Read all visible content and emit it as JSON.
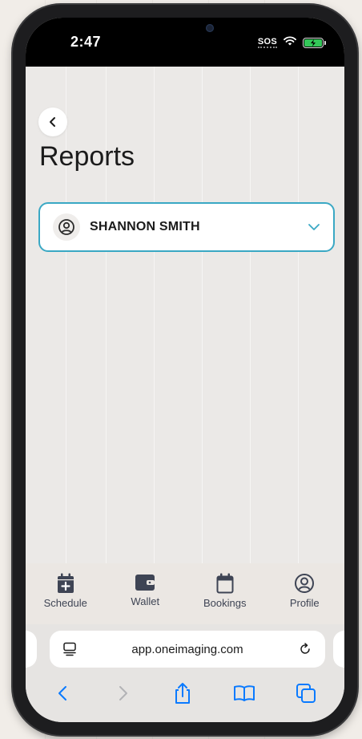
{
  "status": {
    "time": "2:47",
    "carrier": "SOS"
  },
  "header": {
    "title": "Reports"
  },
  "patient_select": {
    "name": "SHANNON SMITH"
  },
  "tabs": [
    {
      "label": "Schedule",
      "icon": "calendar-plus-icon"
    },
    {
      "label": "Wallet",
      "icon": "wallet-icon"
    },
    {
      "label": "Bookings",
      "icon": "calendar-icon"
    },
    {
      "label": "Profile",
      "icon": "user-circle-icon"
    }
  ],
  "browser": {
    "url": "app.oneimaging.com"
  },
  "colors": {
    "accent": "#3aa8c4",
    "ios_blue": "#0a7aff",
    "tab_icon": "#3e4454"
  }
}
